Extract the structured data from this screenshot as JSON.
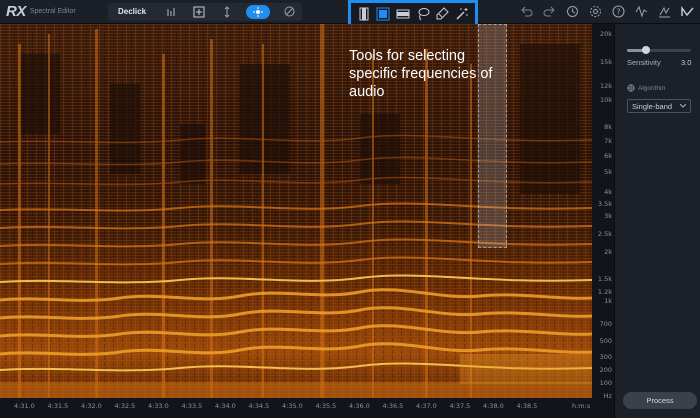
{
  "app": {
    "logo": "RX",
    "module_subtitle": "Spectral Editor",
    "active_module": "Declick"
  },
  "toolbar": {
    "view_icons": [
      "waveform-bars-icon",
      "add-module-icon",
      "split-arrows-icon",
      "spectral-view-icon",
      "disabled-icon"
    ],
    "selection_tools": [
      "time-selection-icon",
      "frequency-selection-icon",
      "time-frequency-selection-icon",
      "lasso-selection-icon",
      "brush-selection-icon",
      "magic-wand-icon"
    ],
    "right_icons": [
      "undo-icon",
      "redo-icon",
      "history-icon",
      "settings-icon",
      "help-icon",
      "audio-signal-icon",
      "route-icon",
      "brand-n-icon"
    ],
    "accent_color": "#1e8ef0"
  },
  "annotation": {
    "line1": "Tools for selecting",
    "line2": "specific frequencies of",
    "line3": "audio"
  },
  "panel": {
    "sensitivity_label": "Sensitivity",
    "sensitivity_value": "3.0",
    "sensitivity_fraction": 0.3,
    "algorithm_label": "Algorithm",
    "algorithm_value": "Single-band",
    "process_label": "Process"
  },
  "freq_axis": [
    "20k",
    "15k",
    "12k",
    "10k",
    "8k",
    "7k",
    "6k",
    "5k",
    "4k",
    "3.5k",
    "3k",
    "2.5k",
    "2k",
    "1.5k",
    "1.2k",
    "1k",
    "700",
    "500",
    "300",
    "200",
    "100",
    "Hz"
  ],
  "time_axis": [
    "4:31.0",
    "4:31.5",
    "4:32.0",
    "4:32.5",
    "4:33.0",
    "4:33.5",
    "4:34.0",
    "4:34.5",
    "4:35.0",
    "4:35.5",
    "4:36.0",
    "4:36.5",
    "4:37.0",
    "4:37.5",
    "4:38.0",
    "4:38.5",
    "h:m:s"
  ]
}
